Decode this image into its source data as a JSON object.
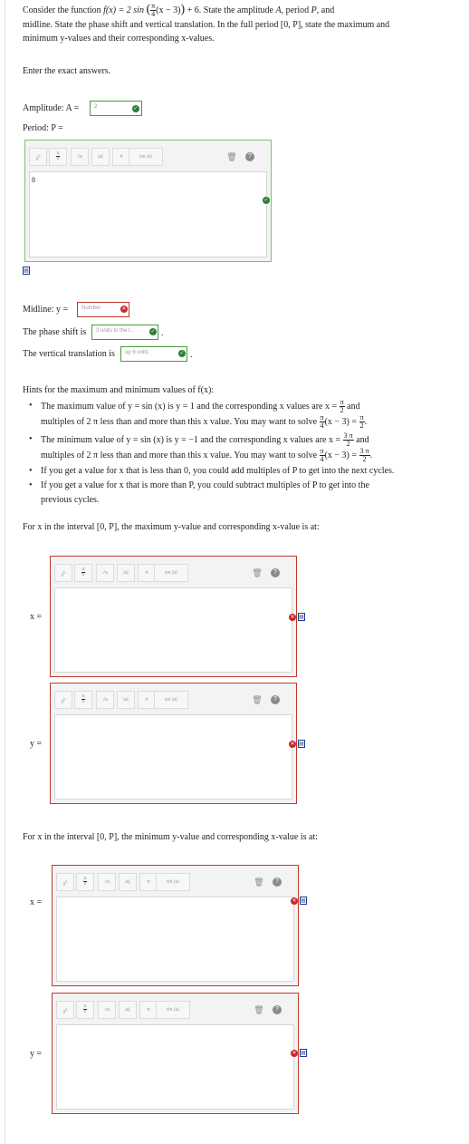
{
  "question": {
    "intro": {
      "t1": "Consider the function",
      "fx": "f(x) = 2 sin",
      "inner": "(x − 3)",
      "tail": "+ 6. State the amplitude",
      "A": "A",
      "period_word": ", period",
      "P": "P",
      "and": ", and",
      "line2": "midline. State the phase shift and vertical translation. In the full period [0, P], state the maximum and",
      "line3": "minimum y-values and their corresponding x-values."
    },
    "pi": "π",
    "four": "4",
    "instruction": "Enter the exact answers."
  },
  "amplitude": {
    "label": "Amplitude: A =",
    "value": "2",
    "status": "correct"
  },
  "period": {
    "label": "Period: P =",
    "value": "8",
    "status": "correct"
  },
  "midline": {
    "label": "Midline: y =",
    "placeholder": "Number",
    "status": "incorrect"
  },
  "phase_shift": {
    "label": "The phase shift is",
    "value": "3 units to the r...",
    "status": "correct"
  },
  "vertical": {
    "label": "The vertical translation is",
    "value": "up 6 units",
    "status": "correct"
  },
  "toolbar": {
    "power": "a",
    "power_sup": "b",
    "frac_top": "a",
    "frac_bot": "b",
    "sqrt": "√a",
    "abs": "|a|",
    "pi": "π",
    "sin": "sin (a)",
    "trash": "🗑",
    "help": "?"
  },
  "hints": {
    "title": "Hints for the maximum and minimum values of f(x):",
    "items": [
      {
        "a": "The maximum value of y = sin (x) is y = 1 and the corresponding x values are x =",
        "rhs_n": "π",
        "rhs_d": "2",
        "b": "and",
        "c": "multiples of 2 π less than and more than this x value. You may want to solve",
        "eq": "(x − 3) =",
        "eq_n": "π",
        "eq_d": "2"
      },
      {
        "a": "The minimum value of y = sin (x) is y = −1 and the corresponding x values are x =",
        "rhs_n": "3 π",
        "rhs_d": "2",
        "b": "and",
        "c": "multiples of 2 π less than and more than this x value. You may want to solve",
        "eq": "(x − 3) =",
        "eq_n": "3 π",
        "eq_d": "2"
      },
      {
        "text": "If you get a value for x that is less than 0, you could add multiples of P to get into the next cycles."
      },
      {
        "text1": "If you get a value for x that is more than P, you could subtract multiples of P to get into the",
        "text2": "previous cycles."
      }
    ]
  },
  "max_section": {
    "prompt": "For x in the interval [0, P], the maximum y-value and corresponding x-value is at:",
    "x_label": "x =",
    "y_label": "y =",
    "status": "incorrect"
  },
  "min_section": {
    "prompt": "For x in the interval [0, P], the minimum y-value and corresponding x-value is at:",
    "x_label": "x =",
    "y_label": "y =",
    "status": "incorrect"
  },
  "colors": {
    "correct": "#2e7d32",
    "incorrect": "#c62828",
    "editor_ok_border": "#7bc46a",
    "editor_bad_border": "#c0392b"
  },
  "icons": {
    "correct": "check-circle-icon",
    "incorrect": "x-circle-icon",
    "preview": "preview-icon"
  }
}
